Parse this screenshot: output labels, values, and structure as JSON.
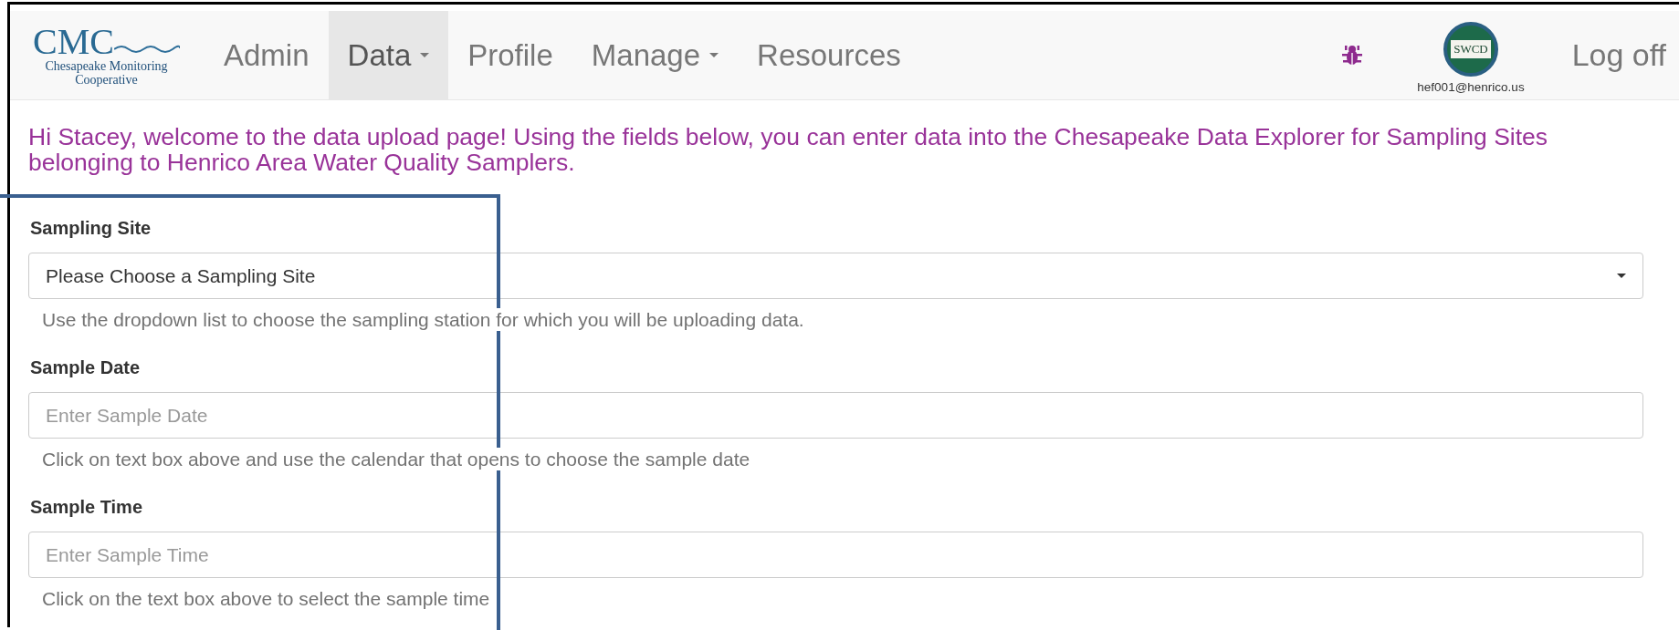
{
  "logo": {
    "title": "CMC",
    "lines": [
      "Chesapeake Monitoring",
      "Cooperative"
    ]
  },
  "nav": [
    {
      "label": "Admin",
      "selected": false,
      "kind": "link"
    },
    {
      "label": "Data",
      "selected": true,
      "kind": "dropdown"
    },
    {
      "label": "Profile",
      "selected": false,
      "kind": "link"
    },
    {
      "label": "Manage",
      "selected": false,
      "kind": "dropdown"
    },
    {
      "label": "Resources",
      "selected": false,
      "kind": "link"
    }
  ],
  "user": {
    "badge": "SWCD",
    "email": "hef001@henrico.us"
  },
  "logoff": "Log off",
  "welcome": "Hi Stacey, welcome to the data upload page! Using the fields below, you can enter data into the Chesapeake Data Explorer for Sampling Sites belonging to Henrico Area Water Quality Samplers.",
  "fields": [
    {
      "label": "Sampling Site",
      "kind": "select",
      "value": "Please Choose a Sampling Site",
      "help": "Use the dropdown list to choose the sampling station for which you will be uploading data."
    },
    {
      "label": "Sample Date",
      "kind": "text",
      "placeholder": "Enter Sample Date",
      "help": "Click on text box above and use the calendar that opens to choose the sample date"
    },
    {
      "label": "Sample Time",
      "kind": "text",
      "placeholder": "Enter Sample Time",
      "help": "Click on the text box above to select the sample time"
    }
  ]
}
